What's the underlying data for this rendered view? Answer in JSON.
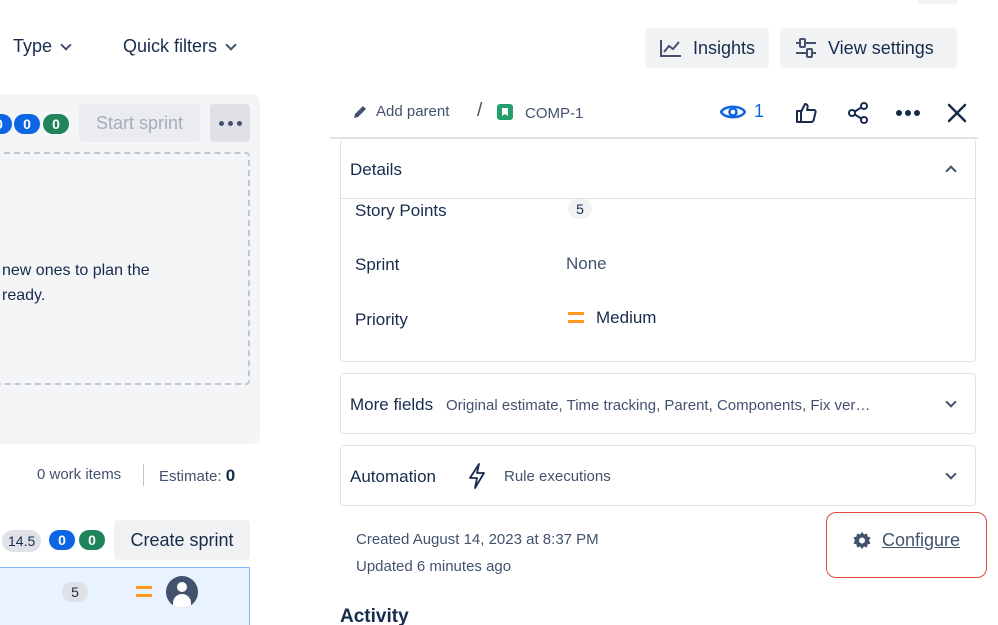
{
  "toolbar": {
    "type_label": "Type",
    "quick_filters_label": "Quick filters",
    "insights_label": "Insights",
    "view_settings_label": "View settings"
  },
  "sprint": {
    "badge_partial": "0",
    "badge_blue": "0",
    "badge_green": "0",
    "start_sprint_label": "Start sprint",
    "empty_line1": "new ones to plan the",
    "empty_line2": "ready.",
    "work_items": "0 work items",
    "estimate_label": "Estimate:",
    "estimate_value": "0"
  },
  "backlog": {
    "points": "14.5",
    "badge_blue": "0",
    "badge_green": "0",
    "create_sprint_label": "Create sprint",
    "row_points": "5"
  },
  "issue": {
    "add_parent_label": "Add parent",
    "separator": "/",
    "key": "COMP-1",
    "watchers": "1",
    "details_title": "Details",
    "fields": {
      "story_points_label": "Story Points",
      "story_points_value": "5",
      "sprint_label": "Sprint",
      "sprint_value": "None",
      "priority_label": "Priority",
      "priority_value": "Medium"
    },
    "more_fields_title": "More fields",
    "more_fields_summary": "Original estimate, Time tracking, Parent, Components, Fix ver…",
    "automation_title": "Automation",
    "automation_summary": "Rule executions",
    "created": "Created August 14, 2023 at 8:37 PM",
    "updated": "Updated 6 minutes ago",
    "configure_label": "Configure",
    "activity_title": "Activity"
  },
  "colors": {
    "badge_blue": "#0c66e4",
    "badge_green": "#1f845a",
    "priority_medium": "#ff991f",
    "highlight_border": "#e2483d"
  }
}
